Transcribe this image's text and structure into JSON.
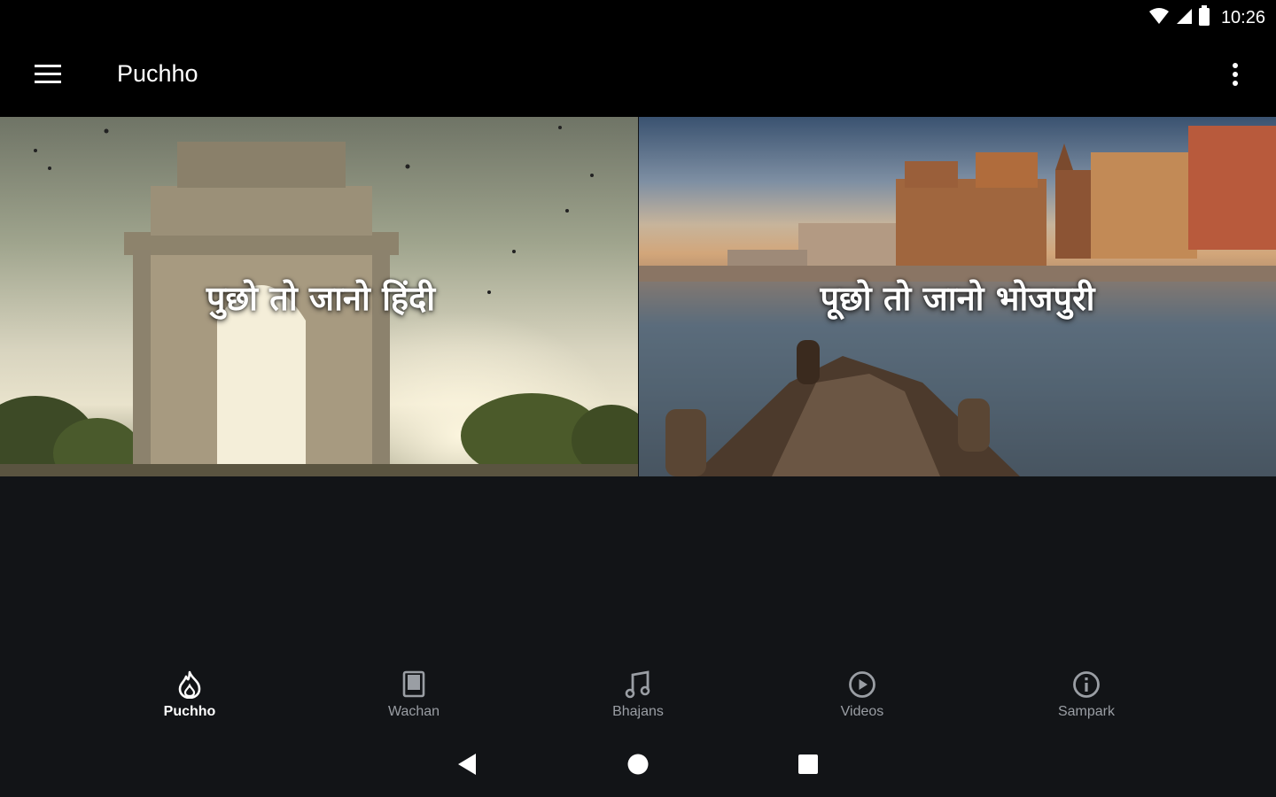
{
  "status_bar": {
    "time": "10:26",
    "icons": [
      "wifi-icon",
      "cell-signal-icon",
      "battery-icon"
    ]
  },
  "app_bar": {
    "title": "Puchho",
    "menu_icon": "hamburger-menu-icon",
    "overflow_icon": "more-vert-icon"
  },
  "cards": [
    {
      "title": "पुछो तो जानो हिंदी",
      "image": "india-gate-photo"
    },
    {
      "title": "पूछो तो जानो भोजपुरी",
      "image": "varanasi-ghats-boat-photo"
    }
  ],
  "bottom_nav": {
    "items": [
      {
        "label": "Puchho",
        "icon": "flame-icon",
        "active": true
      },
      {
        "label": "Wachan",
        "icon": "book-icon",
        "active": false
      },
      {
        "label": "Bhajans",
        "icon": "music-note-icon",
        "active": false
      },
      {
        "label": "Videos",
        "icon": "play-circle-icon",
        "active": false
      },
      {
        "label": "Sampark",
        "icon": "info-icon",
        "active": false
      }
    ]
  },
  "system_nav": {
    "icons": [
      "back-icon",
      "home-icon",
      "recents-icon"
    ]
  },
  "colors": {
    "background": "#121417",
    "bars": "#000000",
    "active_label": "#ffffff",
    "inactive_label": "#9a9ea4"
  }
}
